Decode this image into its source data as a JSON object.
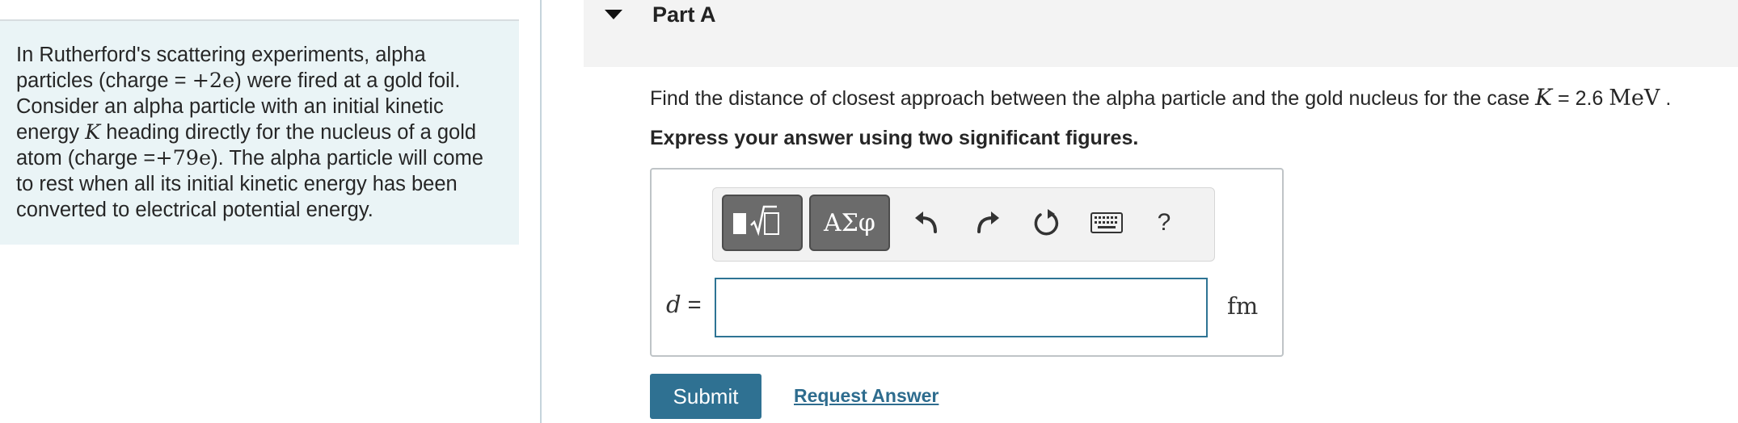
{
  "problem": {
    "intro_1": "In Rutherford's scattering experiments, alpha particles (charge = ",
    "intro_charge_alpha": "+2e",
    "intro_2": ") were fired at a gold foil. Consider an alpha particle with an initial kinetic energy ",
    "intro_K": "K",
    "intro_3": " heading directly for the nucleus of a gold atom (charge =",
    "intro_charge_gold": "+79e",
    "intro_4": "). The alpha particle will come to rest when all its initial kinetic energy has been converted to electrical potential energy."
  },
  "part": {
    "title": "Part A",
    "question_text": "Find the distance of closest approach between the alpha particle and the gold nucleus for the case ",
    "question_var": "K",
    "question_eq": " = 2.6 ",
    "question_unit": "MeV",
    "question_end": " .",
    "instruction": "Express your answer using two significant figures."
  },
  "toolbar": {
    "greek_label": "ΑΣφ",
    "help_label": "?",
    "icons": [
      "templates-icon",
      "undo-icon",
      "redo-icon",
      "reset-icon",
      "keyboard-icon",
      "help-icon"
    ]
  },
  "answer": {
    "variable": "d",
    "equals": " =",
    "value": "",
    "unit": "fm"
  },
  "actions": {
    "submit_label": "Submit",
    "request_label": "Request Answer"
  },
  "colors": {
    "intro_bg": "#eaf4f6",
    "header_bg": "#f3f3f3",
    "submit_bg": "#2f7192",
    "link": "#2e6c8e",
    "input_border": "#2e7494"
  }
}
